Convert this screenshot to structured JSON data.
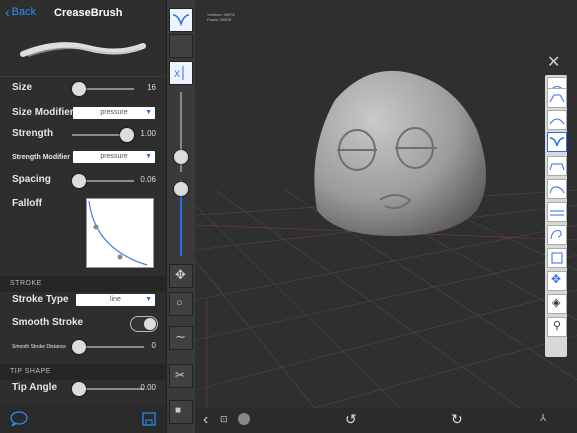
{
  "header": {
    "back_label": "Back",
    "brush_name": "CreaseBrush"
  },
  "settings": {
    "size": {
      "label": "Size",
      "value": "16",
      "fraction": 0.1
    },
    "size_modifier": {
      "label": "Size Modifier",
      "option": "pressure"
    },
    "strength": {
      "label": "Strength",
      "value": "1.00",
      "fraction": 1.0
    },
    "strength_modifier": {
      "label": "Strength Modifier",
      "option": "pressure"
    },
    "spacing": {
      "label": "Spacing",
      "value": "0.06",
      "fraction": 0.06
    },
    "falloff": {
      "label": "Falloff"
    }
  },
  "stroke_section": {
    "title": "STROKE",
    "stroke_type": {
      "label": "Stroke Type",
      "option": "line"
    },
    "smooth_stroke": {
      "label": "Smooth Stroke",
      "on": false
    },
    "smooth_distance": {
      "label": "Smooth Stroke Distance",
      "value": "0",
      "fraction": 0.0
    }
  },
  "tip_section": {
    "title": "TIP SHAPE",
    "tip_angle": {
      "label": "Tip Angle",
      "value": "0.00",
      "fraction": 0.0
    }
  },
  "viewport": {
    "stats": [
      "Vertices: 98978",
      "Faces: 98978"
    ]
  },
  "right_tools": [
    "Draw",
    "Clay",
    "Smooth",
    "Crease",
    "Flatten",
    "Fill",
    "Pinch",
    "Inflate",
    "Mask",
    "Move",
    "Grab",
    "Layer"
  ],
  "colors": {
    "accent": "#2b8ef5",
    "panel": "#2e2e2e",
    "viewport": "#2f2f2f"
  }
}
